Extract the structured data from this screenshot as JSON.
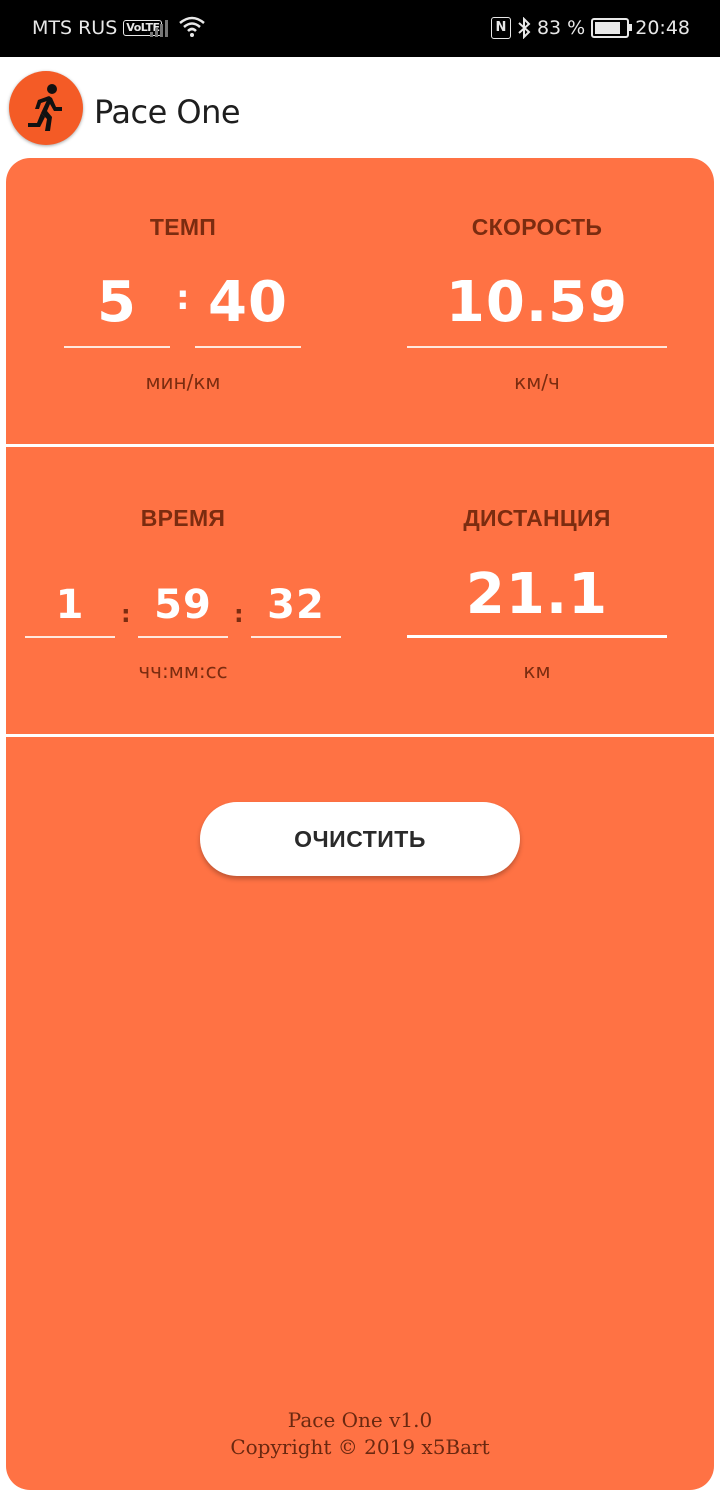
{
  "status_bar": {
    "carrier": "MTS RUS",
    "volte": "VoLTE",
    "nfc": "N",
    "battery_percent": "83 %",
    "battery_level": 0.83,
    "time": "20:48"
  },
  "app": {
    "title": "Pace One",
    "logo_icon": "runner-icon"
  },
  "pace": {
    "label": "ТЕМП",
    "minutes": "5",
    "seconds": "40",
    "unit": "мин/км"
  },
  "speed": {
    "label": "СКОРОСТЬ",
    "value": "10.59",
    "unit": "км/ч"
  },
  "time": {
    "label": "ВРЕМЯ",
    "hours": "1",
    "minutes": "59",
    "seconds": "32",
    "unit": "чч:мм:сс"
  },
  "distance": {
    "label": "ДИСТАНЦИЯ",
    "value": "21.1",
    "unit": "км"
  },
  "actions": {
    "clear_label": "ОЧИСТИТЬ"
  },
  "footer": {
    "version": "Pace One v1.0",
    "copyright": "Copyright © 2019 x5Bart"
  },
  "colors": {
    "accent": "#ff7244",
    "logo": "#f45b26",
    "label_text": "#7b2c10"
  }
}
